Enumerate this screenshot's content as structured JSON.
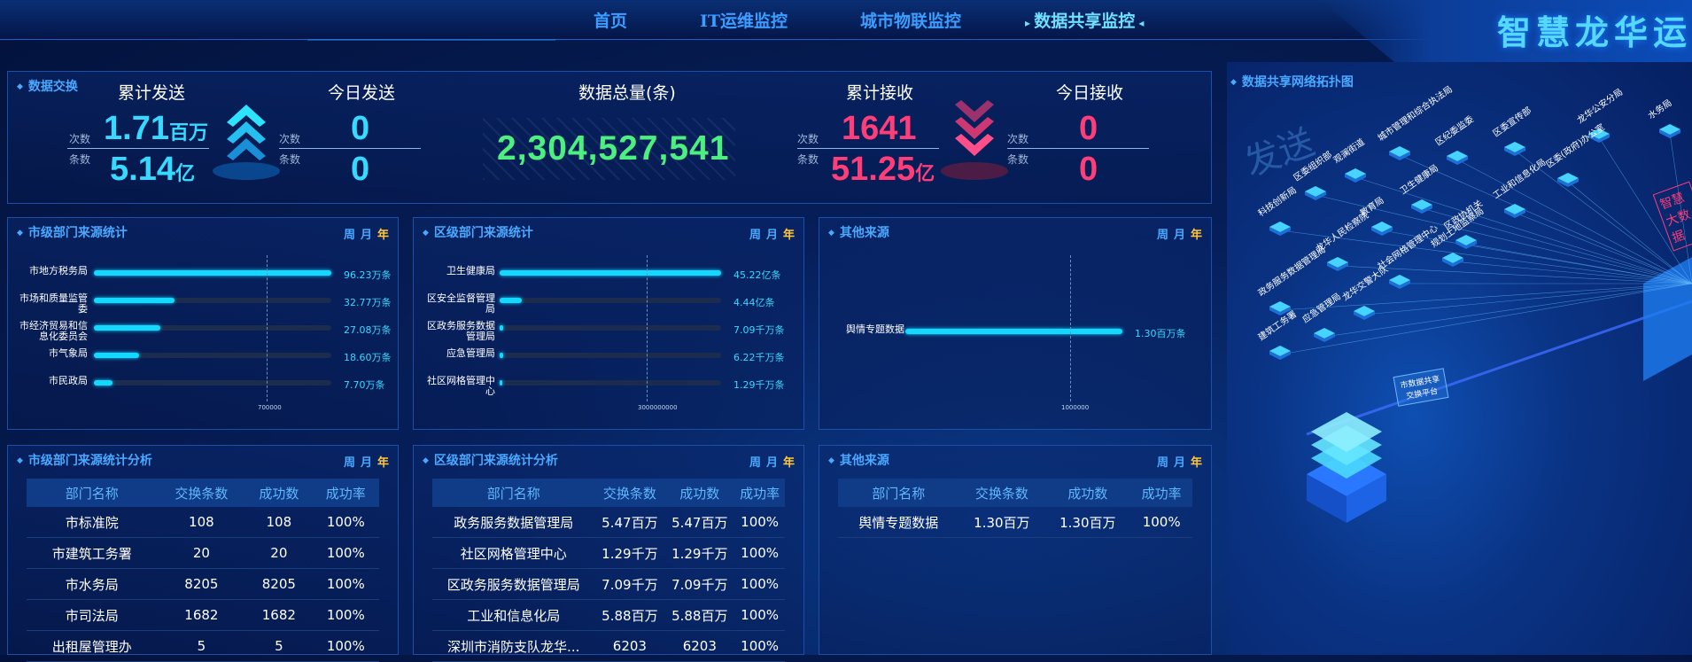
{
  "nav": {
    "items": [
      "首页",
      "IT运维监控",
      "城市物联监控",
      "数据共享监控"
    ],
    "active_index": 3
  },
  "brand": {
    "title": "智慧龙华运"
  },
  "exchange": {
    "title": "数据交换",
    "sent_total": {
      "label": "累计发送",
      "count_label": "次数",
      "count": "1.71",
      "count_unit": "百万",
      "rows_label": "条数",
      "rows": "5.14",
      "rows_unit": "亿"
    },
    "sent_today": {
      "label": "今日发送",
      "count_label": "次数",
      "count": "0",
      "rows_label": "条数",
      "rows": "0"
    },
    "total": {
      "label": "数据总量(条)",
      "value": "2,304,527,541"
    },
    "recv_total": {
      "label": "累计接收",
      "count_label": "次数",
      "count": "1641",
      "rows_label": "条数",
      "rows": "51.25",
      "rows_unit": "亿"
    },
    "recv_today": {
      "label": "今日接收",
      "count_label": "次数",
      "count": "0",
      "rows_label": "条数",
      "rows": "0"
    }
  },
  "period": {
    "week": "周",
    "month": "月",
    "year": "年",
    "selected": "年"
  },
  "city_stats": {
    "title": "市级部门来源统计",
    "axis_tick": "700000",
    "bars": [
      {
        "label": "市地方税务局",
        "value_text": "96.23万条",
        "ratio": 1.0
      },
      {
        "label": "市场和质量监管委",
        "value_text": "32.77万条",
        "ratio": 0.34
      },
      {
        "label": "市经济贸易和信息化委员会",
        "value_text": "27.08万条",
        "ratio": 0.28
      },
      {
        "label": "市气象局",
        "value_text": "18.60万条",
        "ratio": 0.19
      },
      {
        "label": "市民政局",
        "value_text": "7.70万条",
        "ratio": 0.08
      }
    ]
  },
  "district_stats": {
    "title": "区级部门来源统计",
    "axis_tick": "3000000000",
    "bars": [
      {
        "label": "卫生健康局",
        "value_text": "45.22亿条",
        "ratio": 1.0
      },
      {
        "label": "区安全监督管理局",
        "value_text": "4.44亿条",
        "ratio": 0.098
      },
      {
        "label": "区政务服务数据管理局",
        "value_text": "7.09千万条",
        "ratio": 0.016
      },
      {
        "label": "应急管理局",
        "value_text": "6.22千万条",
        "ratio": 0.014
      },
      {
        "label": "社区网格管理中心",
        "value_text": "1.29千万条",
        "ratio": 0.003
      }
    ]
  },
  "other_stats": {
    "title": "其他来源",
    "axis_tick": "1000000",
    "bars": [
      {
        "label": "舆情专题数据",
        "value_text": "1.30百万条",
        "ratio": 1.0
      }
    ]
  },
  "city_table": {
    "title": "市级部门来源统计分析",
    "headers": [
      "部门名称",
      "交换条数",
      "成功数",
      "成功率"
    ],
    "rows": [
      [
        "市标准院",
        "108",
        "108",
        "100%"
      ],
      [
        "市建筑工务署",
        "20",
        "20",
        "100%"
      ],
      [
        "市水务局",
        "8205",
        "8205",
        "100%"
      ],
      [
        "市司法局",
        "1682",
        "1682",
        "100%"
      ],
      [
        "出租屋管理办",
        "5",
        "5",
        "100%"
      ]
    ]
  },
  "district_table": {
    "title": "区级部门来源统计分析",
    "headers": [
      "部门名称",
      "交换条数",
      "成功数",
      "成功率"
    ],
    "rows": [
      [
        "政务服务数据管理局",
        "5.47百万",
        "5.47百万",
        "100%"
      ],
      [
        "社区网格管理中心",
        "1.29千万",
        "1.29千万",
        "100%"
      ],
      [
        "区政务服务数据管理局",
        "7.09千万",
        "7.09千万",
        "100%"
      ],
      [
        "工业和信息化局",
        "5.88百万",
        "5.88百万",
        "100%"
      ],
      [
        "深圳市消防支队龙华...",
        "6203",
        "6203",
        "100%"
      ]
    ]
  },
  "other_table": {
    "title": "其他来源",
    "headers": [
      "部门名称",
      "交换条数",
      "成功数",
      "成功率"
    ],
    "rows": [
      [
        "舆情专题数据",
        "1.30百万",
        "1.30百万",
        "100%"
      ]
    ]
  },
  "topology": {
    "title": "数据共享网络拓扑图",
    "send_label": "发送",
    "platform_label": "市数据共享交换平台",
    "big_label": "智慧大数据",
    "nodes": [
      "科技创新局",
      "区委组织部",
      "观澜街道",
      "城市管理和综合执法局",
      "区纪委监委",
      "区委宣传部",
      "龙华公安分局",
      "水务局",
      "政务服务数据管理局",
      "龙华人民检察院",
      "教育局",
      "卫生健康局",
      "区政协机关",
      "工业和信息化局",
      "区委(政府)办公室",
      "社会网格管理中心",
      "规划土地监察局",
      "龙华交警大队",
      "应急管理局",
      "建筑工务署"
    ]
  },
  "colors": {
    "accent": "#37d9ff",
    "pink": "#ff3d78",
    "green": "#4df07f",
    "year": "#ffc637"
  }
}
